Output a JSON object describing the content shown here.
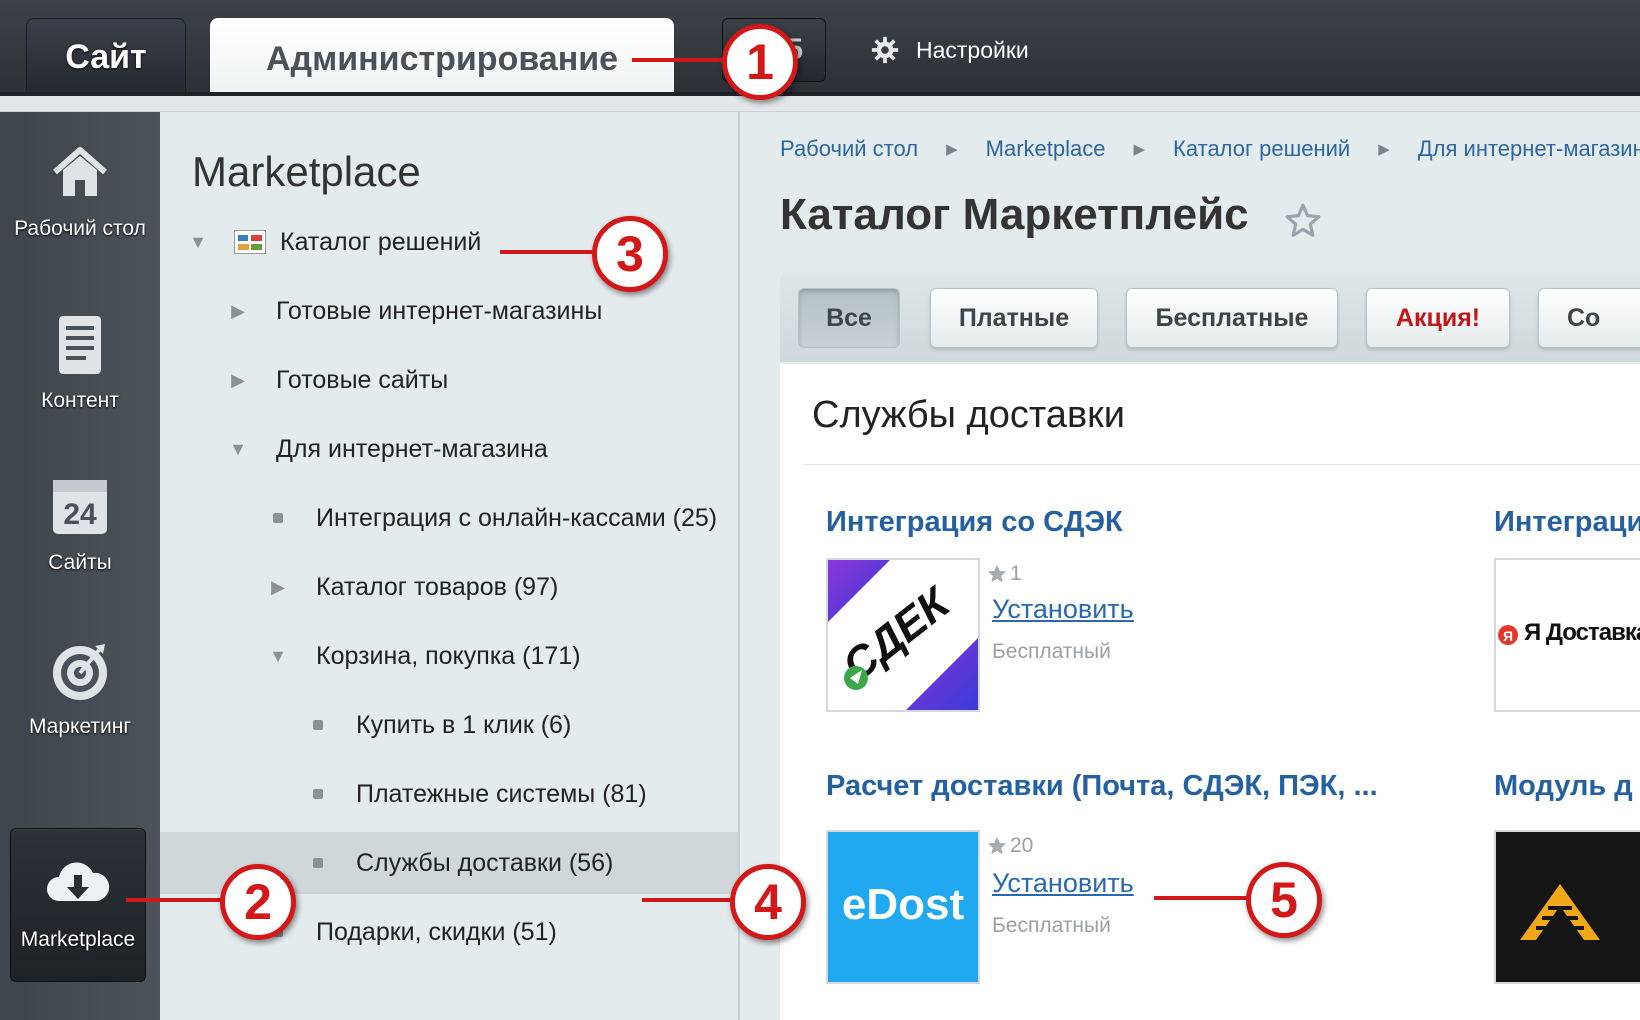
{
  "topbar": {
    "tab_site": "Сайт",
    "tab_admin": "Администрирование",
    "hidden_button_partial": "5",
    "settings_label": "Настройки"
  },
  "sidebar": {
    "items": [
      {
        "label": "Рабочий стол",
        "icon": "home-icon"
      },
      {
        "label": "Контент",
        "icon": "document-icon"
      },
      {
        "label": "Сайты",
        "icon": "calendar-24-icon"
      },
      {
        "label": "Маркетинг",
        "icon": "target-icon"
      },
      {
        "label": "Marketplace",
        "icon": "cloud-download-icon",
        "active": true
      }
    ]
  },
  "tree": {
    "title": "Marketplace",
    "items": [
      {
        "label": "Каталог решений",
        "marker": "expanded"
      },
      {
        "label": "Готовые интернет-магазины",
        "marker": "collapsed"
      },
      {
        "label": "Готовые сайты",
        "marker": "collapsed"
      },
      {
        "label": "Для интернет-магазина",
        "marker": "expanded"
      },
      {
        "label": "Интеграция с онлайн-кассами (25)",
        "marker": "bullet"
      },
      {
        "label": "Каталог товаров (97)",
        "marker": "collapsed"
      },
      {
        "label": "Корзина, покупка (171)",
        "marker": "expanded"
      },
      {
        "label": "Купить в 1 клик (6)",
        "marker": "bullet"
      },
      {
        "label": "Платежные системы (81)",
        "marker": "bullet"
      },
      {
        "label": "Службы доставки (56)",
        "marker": "bullet",
        "selected": true
      },
      {
        "label": "Подарки, скидки (51)",
        "marker": "bullet"
      }
    ]
  },
  "main": {
    "breadcrumb": [
      "Рабочий стол",
      "Marketplace",
      "Каталог решений",
      "Для интернет-магазин"
    ],
    "title": "Каталог Маркетплейс",
    "filters": [
      "Все",
      "Платные",
      "Бесплатные",
      "Акция!",
      "Со"
    ],
    "section_title": "Службы доставки",
    "cards": [
      {
        "title": "Интеграция со СДЭК",
        "rating": "1",
        "install": "Установить",
        "price": "Бесплатный",
        "logo_text": "СДЕК"
      },
      {
        "title": "Интеграци",
        "logo_text": "Я Доставка"
      },
      {
        "title": "Расчет доставки (Почта, СДЭК, ПЭК, ...",
        "rating": "20",
        "install": "Установить",
        "price": "Бесплатный",
        "logo_text": "eDost"
      },
      {
        "title": "Модуль д"
      }
    ]
  },
  "callouts": [
    "1",
    "2",
    "3",
    "4",
    "5"
  ],
  "colors": {
    "callout": "#d21818",
    "link": "#2560a0",
    "promo": "#c01818"
  }
}
